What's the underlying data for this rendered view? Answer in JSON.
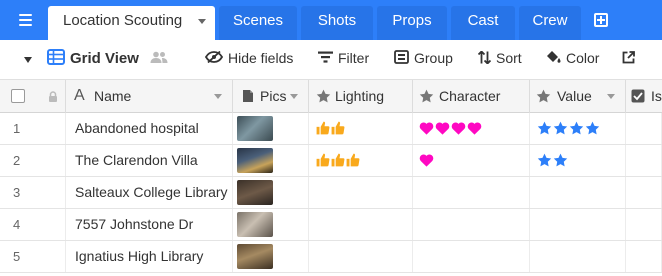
{
  "tabs": {
    "active": "Location Scouting",
    "others": [
      "Scenes",
      "Shots",
      "Props",
      "Cast",
      "Crew"
    ]
  },
  "toolbar": {
    "view_name": "Grid View",
    "hide_fields": "Hide fields",
    "filter": "Filter",
    "group": "Group",
    "sort": "Sort",
    "color": "Color"
  },
  "columns": {
    "name": "Name",
    "pics": "Pics",
    "lighting": "Lighting",
    "character": "Character",
    "value": "Value",
    "partial": "Is"
  },
  "rows": [
    {
      "num": "1",
      "name": "Abandoned hospital",
      "lighting": 2,
      "character": 4,
      "value": 4
    },
    {
      "num": "2",
      "name": "The Clarendon Villa",
      "lighting": 3,
      "character": 1,
      "value": 2
    },
    {
      "num": "3",
      "name": "Salteaux College Library",
      "lighting": 0,
      "character": 0,
      "value": 0
    },
    {
      "num": "4",
      "name": "7557 Johnstone Dr",
      "lighting": 0,
      "character": 0,
      "value": 0
    },
    {
      "num": "5",
      "name": "Ignatius High Library",
      "lighting": 0,
      "character": 0,
      "value": 0
    }
  ],
  "colors": {
    "brand_blue": "#2d7ff9",
    "thumbs_up": "#f9a91c",
    "heart": "#ff08c2",
    "star": "#2d7ff9"
  }
}
